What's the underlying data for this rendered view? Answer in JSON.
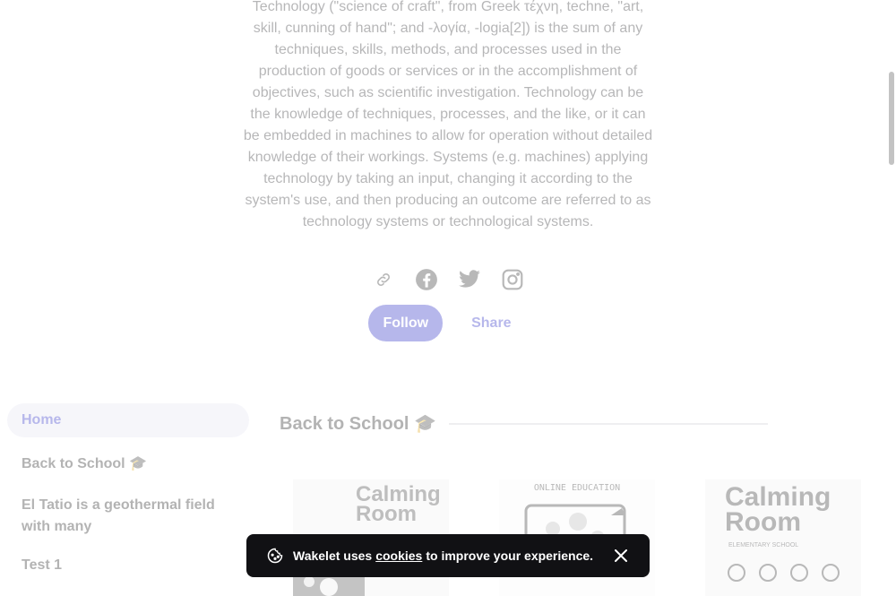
{
  "description": "Technology (\"science of craft\", from Greek τέχνη, techne, \"art, skill, cunning of hand\"; and -λογία, -logia[2]) is the sum of any techniques, skills, methods, and processes used in the production of goods or services or in the accomplishment of objectives, such as scientific investigation. Technology can be the knowledge of techniques, processes, and the like, or it can be embedded in machines to allow for operation without detailed knowledge of their workings. Systems (e.g. machines) applying technology by taking an input, changing it according to the system's use, and then producing an outcome are referred to as technology systems or technological systems.",
  "social": [
    "link-icon",
    "facebook-icon",
    "twitter-icon",
    "instagram-icon"
  ],
  "actions": {
    "follow_label": "Follow",
    "share_label": "Share"
  },
  "sidebar": {
    "items": [
      {
        "label": "Home"
      },
      {
        "label": "Back to School 🎓"
      },
      {
        "label": "El Tatio is a geothermal field with many"
      },
      {
        "label": "Test 1"
      }
    ]
  },
  "section": {
    "title": "Back to School 🎓"
  },
  "cards": [
    {
      "title": "Calming Room",
      "subtitle": ""
    },
    {
      "title": "",
      "subtitle": "ONLINE EDUCATION"
    },
    {
      "title": "Calming Room",
      "subtitle": "ELEMENTARY SCHOOL"
    }
  ],
  "toast": {
    "text_before": "Wakelet uses",
    "link": "cookies",
    "text_after": "to improve your experience."
  },
  "colors": {
    "accent": "#2d2ec6",
    "toast_bg": "#111114",
    "active_bg": "#e6e6f3"
  }
}
